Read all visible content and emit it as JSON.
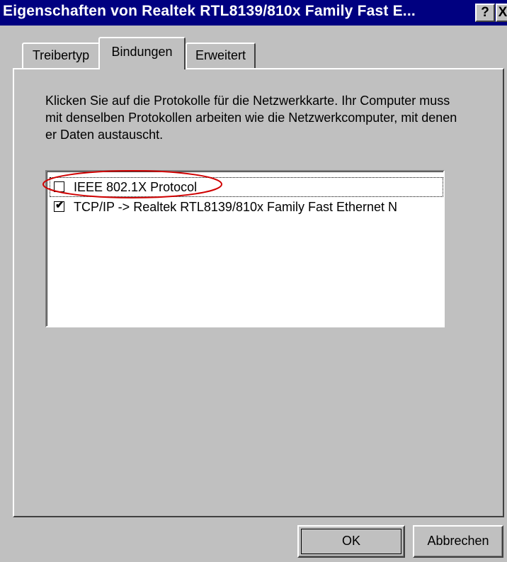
{
  "window": {
    "title": "Eigenschaften von Realtek RTL8139/810x Family Fast E...",
    "help_label": "?",
    "close_label": "X"
  },
  "tabs": [
    {
      "label": "Treibertyp",
      "active": false
    },
    {
      "label": "Bindungen",
      "active": true
    },
    {
      "label": "Erweitert",
      "active": false
    }
  ],
  "bindungen": {
    "description": "Klicken Sie auf die Protokolle für die Netzwerkkarte. Ihr Computer muss mit denselben Protokollen arbeiten wie die Netzwerkcomputer, mit denen er Daten austauscht.",
    "protocols": [
      {
        "label": "IEEE 802.1X Protocol",
        "checked": false,
        "focused": true
      },
      {
        "label": "TCP/IP -> Realtek RTL8139/810x Family Fast Ethernet N",
        "checked": true,
        "focused": false
      }
    ],
    "highlight_color": "#d00000"
  },
  "buttons": {
    "ok": "OK",
    "cancel": "Abbrechen"
  },
  "colors": {
    "titlebar": "#000080",
    "face": "#c0c0c0"
  }
}
